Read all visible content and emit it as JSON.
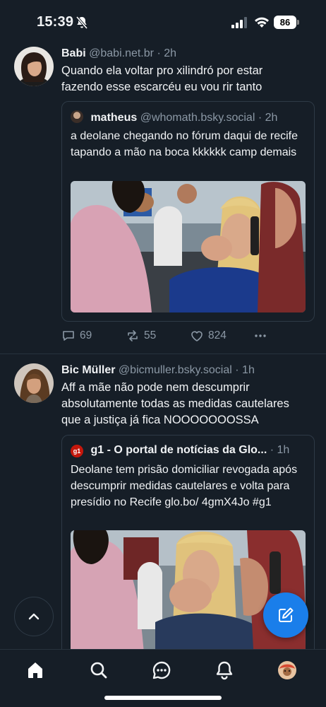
{
  "status_bar": {
    "time": "15:39",
    "battery": "86"
  },
  "posts": [
    {
      "author_name": "Babi",
      "author_handle": "@babi.net.br",
      "time": "2h",
      "text": "Quando ela voltar pro xilindró por estar fazendo esse escarcéu eu vou rir tanto",
      "quote": {
        "author_name": "matheus",
        "author_handle": "@whomath.bsky.social",
        "time": "2h",
        "text": "a deolane chegando no fórum daqui de recife tapando a mão na boca kkkkkk camp demais"
      },
      "replies": "69",
      "reposts": "55",
      "likes": "824"
    },
    {
      "author_name": "Bic Müller",
      "author_handle": "@bicmuller.bsky.social",
      "time": "1h",
      "text": "Aff a mãe não pode nem descumprir absolutamente todas as medidas cautelares que a justiça já fica NOOOOOOOSSA",
      "quote": {
        "author_name": "g1 - O portal de notícias da Glo...",
        "time": "1h",
        "text": "Deolane tem prisão domiciliar revogada após descumprir medidas cautelares e volta para presídio no Recife glo.bo/ 4gmX4Jo #g1",
        "avatar_label": "g1"
      }
    }
  ],
  "colors": {
    "background": "#161e27",
    "accent": "#1a7eea",
    "muted": "#8b98a5",
    "g1_red": "#c4170c"
  },
  "icons": [
    "bell-off-icon",
    "signal-icon",
    "wifi-icon",
    "reply-icon",
    "repost-icon",
    "like-icon",
    "more-icon",
    "chevron-up-icon",
    "compose-icon",
    "home-icon",
    "search-icon",
    "chat-icon",
    "notifications-icon",
    "profile-avatar"
  ]
}
